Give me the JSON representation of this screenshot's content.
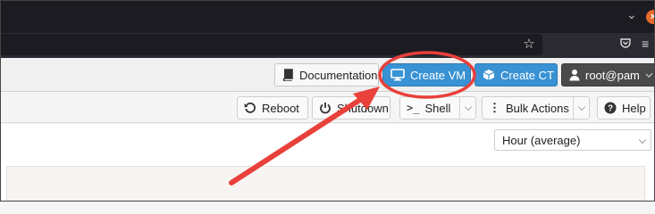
{
  "header": {
    "documentation_label": "Documentation",
    "create_vm_label": "Create VM",
    "create_ct_label": "Create CT",
    "user_label": "root@pam"
  },
  "toolbar": {
    "reboot_label": "Reboot",
    "shutdown_label": "Shutdown",
    "shell_label": "Shell",
    "bulk_actions_label": "Bulk Actions",
    "help_label": "Help"
  },
  "timeframe": {
    "selected": "Hour (average)"
  },
  "colors": {
    "primary_button": "#3892d4",
    "annotation": "#e8403a",
    "user_button": "#4a4a4a"
  }
}
